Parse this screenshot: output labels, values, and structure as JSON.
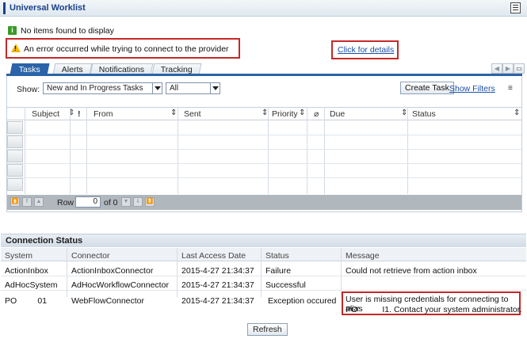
{
  "header": {
    "title": "Universal Worklist"
  },
  "messages": {
    "info": "No items found to display",
    "error": "An error occurred while trying to connect to the provider",
    "details_link": "Click for details"
  },
  "tabs": [
    {
      "label": "Tasks",
      "active": true
    },
    {
      "label": "Alerts",
      "active": false
    },
    {
      "label": "Notifications",
      "active": false
    },
    {
      "label": "Tracking",
      "active": false
    }
  ],
  "filter": {
    "show_label": "Show:",
    "view_value": "New and In Progress Tasks",
    "scope_value": "All",
    "create_task": "Create Task",
    "show_filters": "Show Filters"
  },
  "grid": {
    "columns": [
      "Subject",
      "!",
      "From",
      "Sent",
      "Priority",
      "Due",
      "Status"
    ]
  },
  "pager": {
    "row_label": "Row",
    "row_value": "0",
    "of_label": "of 0"
  },
  "connection_status": {
    "title": "Connection Status",
    "columns": [
      "System",
      "Connector",
      "Last Access Date",
      "Status",
      "Message"
    ],
    "rows": [
      {
        "system": "ActionInbox",
        "connector": "ActionInboxConnector",
        "date": "2015-4-27 21:34:37",
        "status": "Failure",
        "message": "Could not retrieve from action inbox"
      },
      {
        "system": "AdHocSystem",
        "connector": "AdHocWorkflowConnector",
        "date": "2015-4-27 21:34:37",
        "status": "Successful",
        "message": ""
      },
      {
        "system": "PO         01",
        "connector": "WebFlowConnector",
        "date": "2015-4-27 21:34:37",
        "status": "Exception occured",
        "message_line1": "User is missing credentials for connecting to alias",
        "message_line2": "PO'          I1. Contact your system administrator."
      }
    ],
    "refresh": "Refresh"
  },
  "colors": {
    "accent": "#2b63a8",
    "title": "#19408b",
    "error_border": "#c62828",
    "link": "#1a4fa6"
  }
}
